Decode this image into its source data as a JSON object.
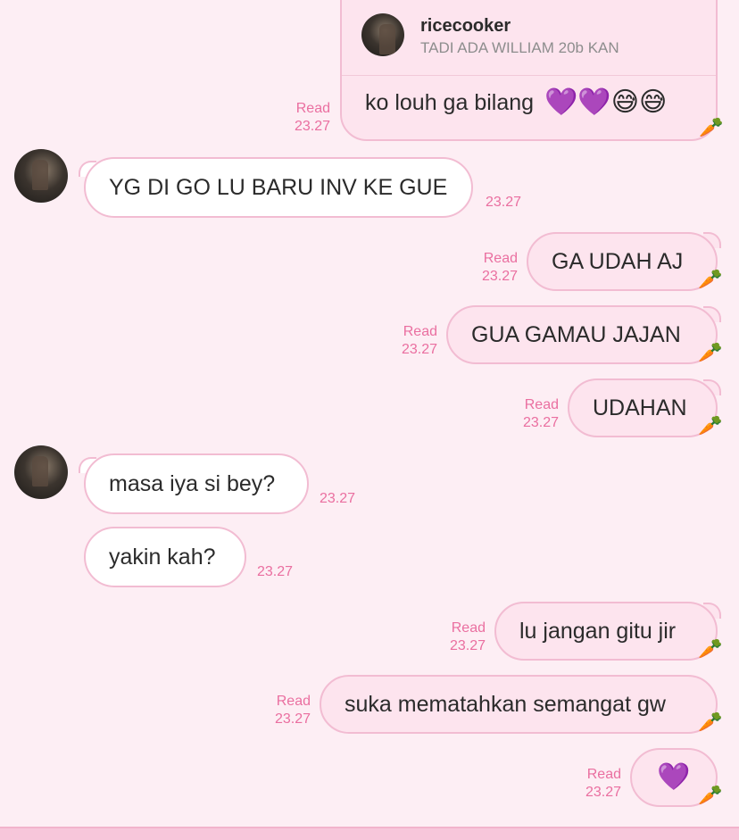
{
  "theme": {
    "background": "#fdeef4",
    "bubble_border": "#f2bcd2",
    "accent": "#ea6fa0"
  },
  "reply_card": {
    "user_name": "ricecooker",
    "quoted_text": "TADI ADA WILLIAM 20b KAN",
    "reply_text": "ko louh ga bilang",
    "emojis": "💜💜😅😅",
    "status": "Read",
    "time": "23.27"
  },
  "messages": [
    {
      "side": "in",
      "text": "YG DI GO LU BARU INV KE GUE",
      "time": "23.27"
    },
    {
      "side": "out",
      "text": "GA UDAH AJ",
      "status": "Read",
      "time": "23.27"
    },
    {
      "side": "out",
      "text": "GUA GAMAU JAJAN",
      "status": "Read",
      "time": "23.27"
    },
    {
      "side": "out",
      "text": "UDAHAN",
      "status": "Read",
      "time": "23.27"
    },
    {
      "side": "in",
      "text": "masa iya si bey?",
      "time": "23.27"
    },
    {
      "side": "in",
      "text": "yakin kah?",
      "time": "23.27"
    },
    {
      "side": "out",
      "text": "lu jangan gitu jir",
      "status": "Read",
      "time": "23.27"
    },
    {
      "side": "out",
      "text": "suka mematahkan semangat gw",
      "status": "Read",
      "time": "23.27"
    },
    {
      "side": "out",
      "text": "💜",
      "status": "Read",
      "time": "23.27"
    }
  ],
  "icons": {
    "carrot": "🥕"
  }
}
